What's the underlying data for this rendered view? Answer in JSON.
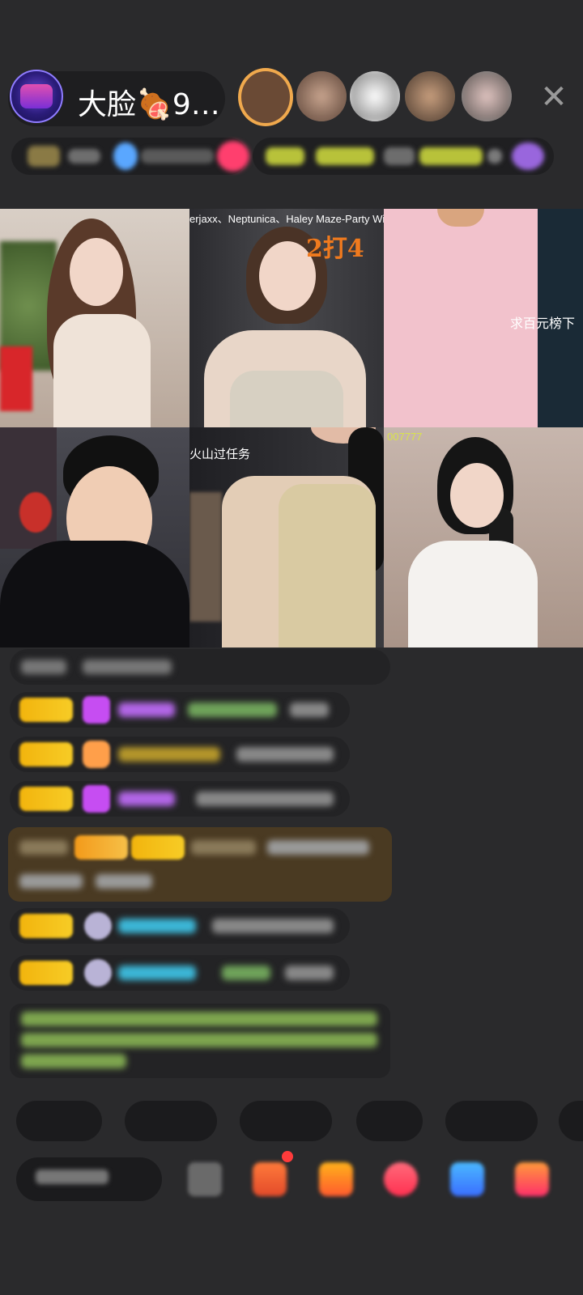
{
  "header": {
    "host_name": "大脸🍖9…",
    "close_glyph": "✕"
  },
  "grid": {
    "tile_texts": {
      "t1_caption": "",
      "t2_music": "erjaxx、Neptunica、Haley Maze-Party With The Cops (",
      "t2_badge": "2打4",
      "t3_caption": "求百元榜下",
      "t5_caption": "火山过任务",
      "t6_caption": "007777"
    }
  },
  "chat": {
    "messages": []
  },
  "bottom": {
    "quick_replies": [
      "",
      "",
      "",
      "",
      ""
    ]
  }
}
